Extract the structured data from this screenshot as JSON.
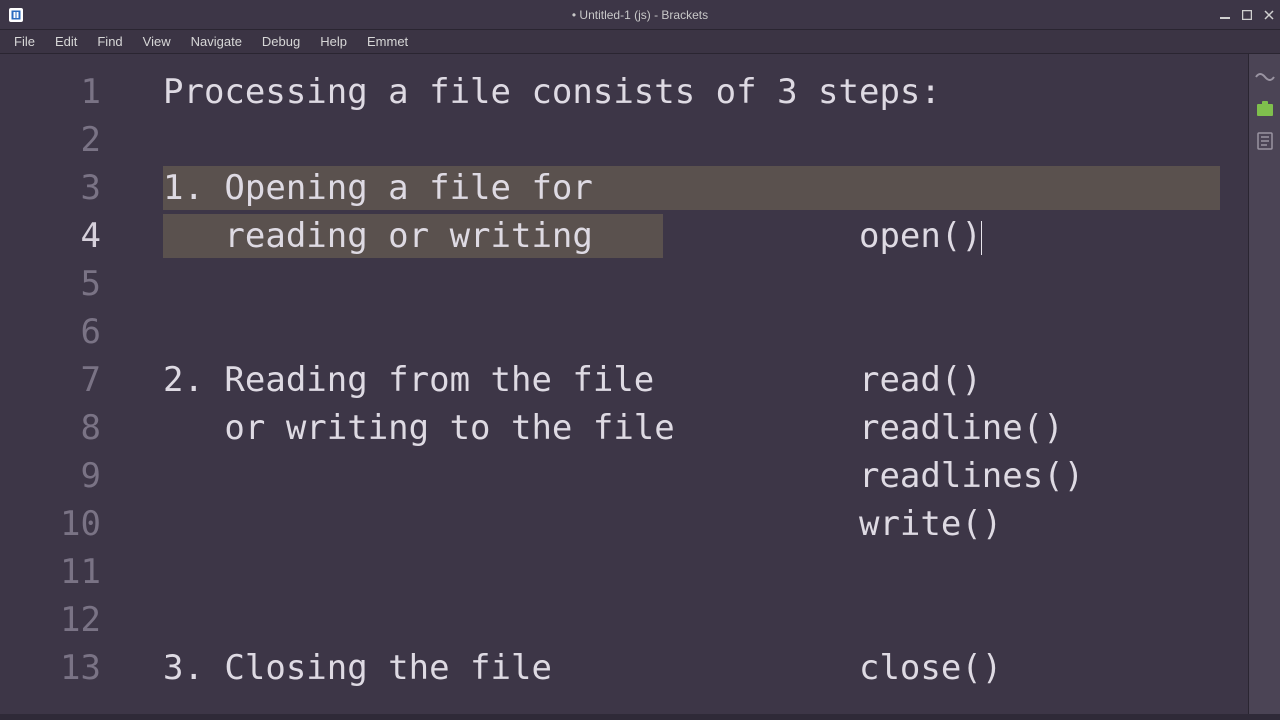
{
  "window": {
    "title": "• Untitled-1 (js) - Brackets"
  },
  "menu": {
    "items": [
      "File",
      "Edit",
      "Find",
      "View",
      "Navigate",
      "Debug",
      "Help",
      "Emmet"
    ]
  },
  "editor": {
    "active_line": 4,
    "selection_start_line": 3,
    "selection_end_line": 4,
    "lines": [
      "Processing a file consists of 3 steps:",
      "",
      "1. Opening a file for",
      "   reading or writing             open()",
      "",
      "",
      "2. Reading from the file          read()",
      "   or writing to the file         readline()",
      "                                  readlines()",
      "                                  write()",
      "",
      "",
      "3. Closing the file               close()"
    ]
  },
  "rightbar": {
    "live_preview_icon": "live-preview",
    "extensions_icon": "extension-manager",
    "doc_icon": "document-outline"
  },
  "colors": {
    "bg": "#3d3647",
    "gutter_text": "#7a7385",
    "code_text": "#dedae3",
    "selection": "#6d6251"
  }
}
